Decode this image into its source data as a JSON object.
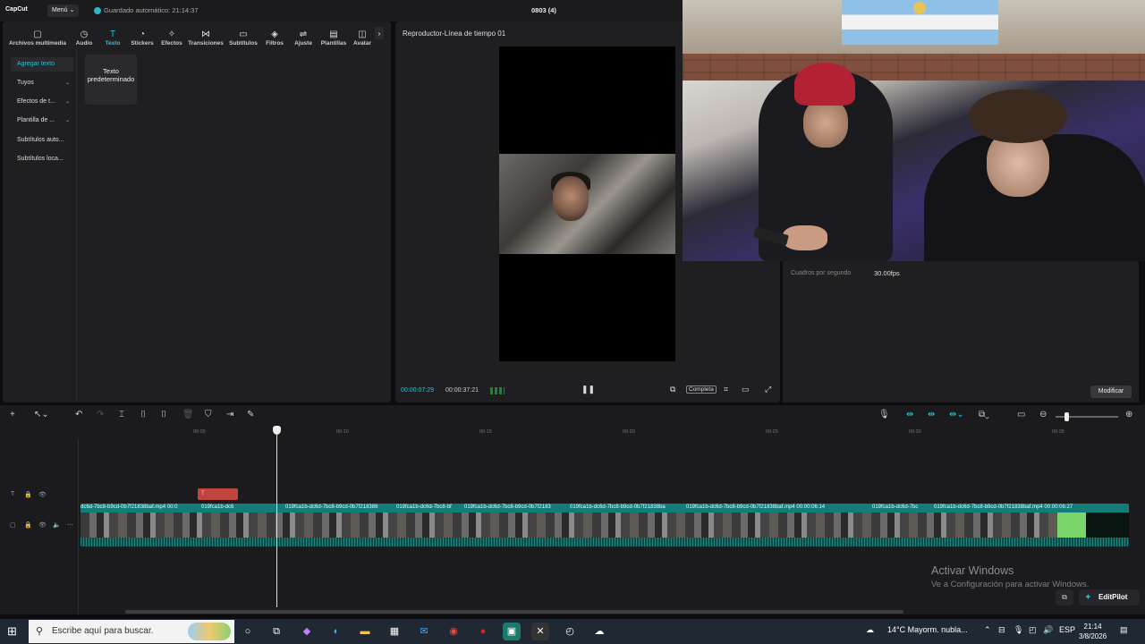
{
  "app": {
    "logo": "CapCut",
    "menu": "Menú",
    "autosave": "Guardado automático: 21:14:37",
    "project_title": "0803 (4)"
  },
  "tabs": [
    {
      "label": "Archivos multimedia",
      "icon": "▢"
    },
    {
      "label": "Audio",
      "icon": "◷"
    },
    {
      "label": "Texto",
      "icon": "T"
    },
    {
      "label": "Stickers",
      "icon": "◔"
    },
    {
      "label": "Efectos",
      "icon": "✧"
    },
    {
      "label": "Transiciones",
      "icon": "⋈"
    },
    {
      "label": "Subtítulos",
      "icon": "▭"
    },
    {
      "label": "Filtros",
      "icon": "◈"
    },
    {
      "label": "Ajuste",
      "icon": "⇌"
    },
    {
      "label": "Plantillas",
      "icon": "▤"
    },
    {
      "label": "Avatar",
      "icon": "◫"
    }
  ],
  "sidenav": [
    {
      "label": "Agregar texto",
      "chev": ""
    },
    {
      "label": "Tuyos",
      "chev": "⌄"
    },
    {
      "label": "Efectos de t...",
      "chev": "⌄"
    },
    {
      "label": "Plantilla de ...",
      "chev": "⌄"
    },
    {
      "label": "Subtítulos auto...",
      "chev": ""
    },
    {
      "label": "Subtítulos loca...",
      "chev": ""
    }
  ],
  "text_card": "Texto predeterminado",
  "player": {
    "title": "Reproductor-Línea de tiempo 01",
    "current": "00:00:07:29",
    "duration": "00:00:37:21",
    "complete": "Completa"
  },
  "properties": {
    "fps_label": "Cuadros por segundo",
    "fps_value": "30.00fps",
    "modify": "Modificar"
  },
  "ruler": [
    "00:05",
    "00:10",
    "00:15",
    "00:20",
    "00:25",
    "00:30",
    "00:35"
  ],
  "text_clip": "T",
  "clips": [
    "dc6d-7bc8-b9cd-0b7f21838baf.mp4  00:0",
    "019fca1b-dc6",
    "019fca1b-dc6d-7bc8-b9cd-0b7f218386",
    "019fca1b-dc6d-7bc8-bf",
    "019fca1b-dc6d-7bc8-b9cd-0b7f2183",
    "019fca1b-dc6d-7bc8-b9cd-0b7f21838ba",
    "019fca1b-dc6d-7bc8-b9cd-0b7f21838baf.mp4   00:00:06:14",
    "019fca1b-dc6d-7bc",
    "019fca1b-dc6d-7bc8-b9cd-0b7f21838baf.mp4   00:00:06:27"
  ],
  "watermark": {
    "line1": "Activar Windows",
    "line2": "Ve a Configuración para activar Windows."
  },
  "editpilot": "EditPilot",
  "taskbar": {
    "search_placeholder": "Escribe aquí para buscar.",
    "weather": "14°C  Mayorm. nubla...",
    "lang": "ESP",
    "time": "21:14",
    "date": "3/8/2026"
  }
}
